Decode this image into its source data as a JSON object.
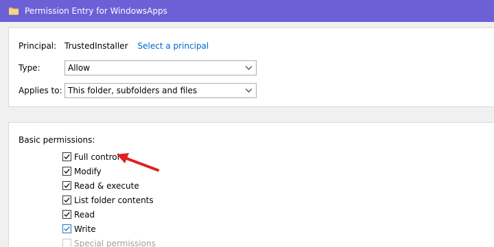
{
  "window": {
    "title": "Permission Entry for WindowsApps",
    "title_icon": "folder-icon",
    "titlebar_color": "#6b60d6"
  },
  "principal": {
    "label": "Principal:",
    "name": "TrustedInstaller",
    "link": "Select a principal",
    "link_color": "#0066cc"
  },
  "type": {
    "label": "Type:",
    "value": "Allow"
  },
  "applies_to": {
    "label": "Applies to:",
    "value": "This folder, subfolders and files"
  },
  "permissions": {
    "title": "Basic permissions:",
    "items": [
      {
        "label": "Full control",
        "checked": true,
        "enabled": true
      },
      {
        "label": "Modify",
        "checked": true,
        "enabled": true
      },
      {
        "label": "Read & execute",
        "checked": true,
        "enabled": true
      },
      {
        "label": "List folder contents",
        "checked": true,
        "enabled": true
      },
      {
        "label": "Read",
        "checked": true,
        "enabled": true
      },
      {
        "label": "Write",
        "checked": true,
        "enabled": true,
        "accent": "#1e6fc8"
      },
      {
        "label": "Special permissions",
        "checked": false,
        "enabled": false
      }
    ]
  },
  "annotation": {
    "icon": "red-arrow-icon",
    "color": "#e02020"
  }
}
